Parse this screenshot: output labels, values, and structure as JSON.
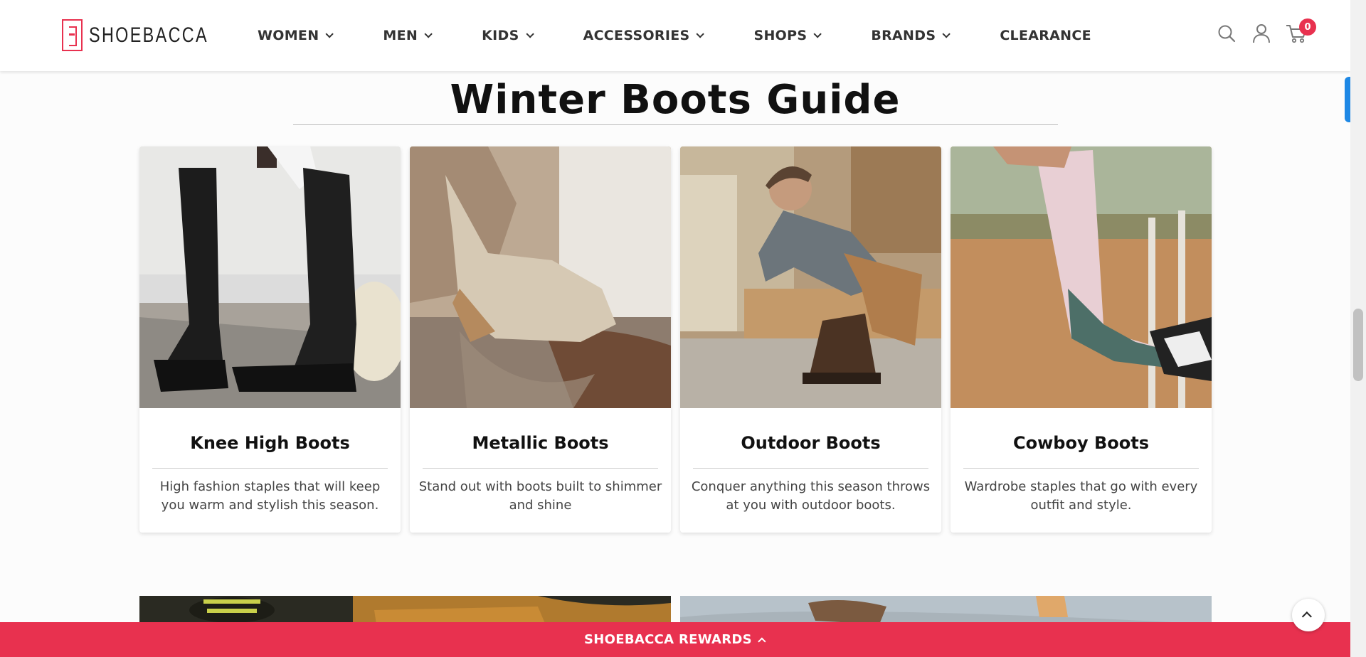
{
  "brand": {
    "name": "SHOEBACCA"
  },
  "nav": {
    "items": [
      {
        "label": "WOMEN",
        "has_dropdown": true
      },
      {
        "label": "MEN",
        "has_dropdown": true
      },
      {
        "label": "KIDS",
        "has_dropdown": true
      },
      {
        "label": "ACCESSORIES",
        "has_dropdown": true
      },
      {
        "label": "SHOPS",
        "has_dropdown": true
      },
      {
        "label": "BRANDS",
        "has_dropdown": true
      },
      {
        "label": "CLEARANCE",
        "has_dropdown": false
      }
    ]
  },
  "header_icons": {
    "search": "search-icon",
    "account": "user-icon",
    "cart": "cart-icon",
    "cart_count": "0"
  },
  "guide": {
    "title": "Winter Boots Guide",
    "cards": [
      {
        "title": "Knee High Boots",
        "description": "High fashion staples that will keep you warm and stylish this season."
      },
      {
        "title": "Metallic Boots",
        "description": "Stand out with boots built to shimmer and shine"
      },
      {
        "title": "Outdoor Boots",
        "description": "Conquer anything this season throws at you with outdoor boots."
      },
      {
        "title": "Cowboy Boots",
        "description": "Wardrobe staples that go with every outfit and style."
      }
    ]
  },
  "rewards_bar": {
    "label": "SHOEBACCA REWARDS"
  },
  "colors": {
    "accent": "#e8314f",
    "side_tab": "#1e88e5"
  }
}
